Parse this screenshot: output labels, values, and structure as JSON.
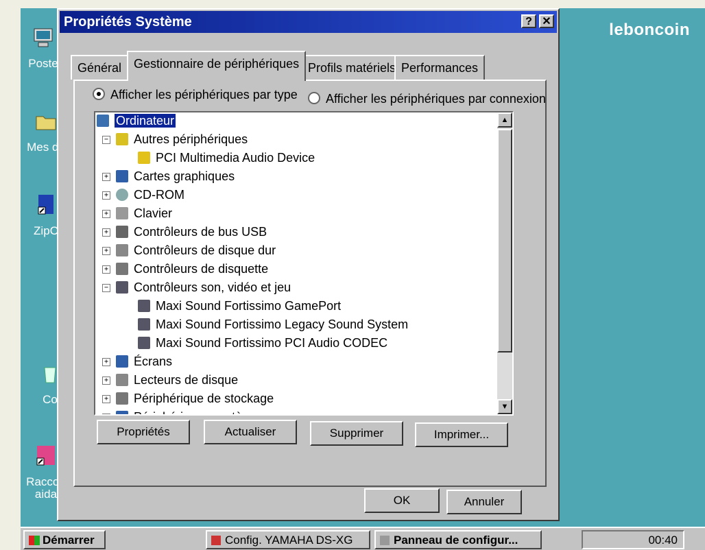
{
  "watermark": "leboncoin",
  "desktop_icons": [
    {
      "label": "Poste",
      "icon": "computer-icon"
    },
    {
      "label": "Mes do",
      "icon": "folder-icon"
    },
    {
      "label": "ZipC",
      "icon": "shortcut-icon"
    },
    {
      "label": "Co",
      "icon": "recycle-bin-icon"
    },
    {
      "label": "Raccou",
      "icon": "shortcut-icon"
    },
    {
      "label": "aida",
      "icon": ""
    }
  ],
  "dialog": {
    "title": "Propriétés Système",
    "help_label": "?",
    "close_label": "✕",
    "tabs": [
      "Général",
      "Gestionnaire de périphériques",
      "Profils matériels",
      "Performances"
    ],
    "active_tab": 1,
    "radio_by_type": "Afficher les périphériques par type",
    "radio_by_connection": "Afficher les périphériques par connexion",
    "tree": [
      {
        "label": "Ordinateur",
        "level": 0,
        "expander": "",
        "selected": true,
        "icon": "computer-icon"
      },
      {
        "label": "Autres périphériques",
        "level": 1,
        "expander": "−",
        "icon": "question-icon"
      },
      {
        "label": "PCI Multimedia Audio Device",
        "level": 2,
        "expander": "",
        "icon": "warning-icon"
      },
      {
        "label": "Cartes graphiques",
        "level": 1,
        "expander": "+",
        "icon": "monitor-icon"
      },
      {
        "label": "CD-ROM",
        "level": 1,
        "expander": "+",
        "icon": "cdrom-icon"
      },
      {
        "label": "Clavier",
        "level": 1,
        "expander": "+",
        "icon": "keyboard-icon"
      },
      {
        "label": "Contrôleurs de bus USB",
        "level": 1,
        "expander": "+",
        "icon": "usb-icon"
      },
      {
        "label": "Contrôleurs de disque dur",
        "level": 1,
        "expander": "+",
        "icon": "harddisk-icon"
      },
      {
        "label": "Contrôleurs de disquette",
        "level": 1,
        "expander": "+",
        "icon": "floppy-icon"
      },
      {
        "label": "Contrôleurs son, vidéo et jeu",
        "level": 1,
        "expander": "−",
        "icon": "sound-icon"
      },
      {
        "label": "Maxi Sound Fortissimo GamePort",
        "level": 2,
        "expander": "",
        "icon": "sound-icon"
      },
      {
        "label": "Maxi Sound Fortissimo Legacy Sound System",
        "level": 2,
        "expander": "",
        "icon": "sound-icon"
      },
      {
        "label": "Maxi Sound Fortissimo PCI Audio CODEC",
        "level": 2,
        "expander": "",
        "icon": "sound-icon"
      },
      {
        "label": "Écrans",
        "level": 1,
        "expander": "+",
        "icon": "monitor-icon"
      },
      {
        "label": "Lecteurs de disque",
        "level": 1,
        "expander": "+",
        "icon": "drive-icon"
      },
      {
        "label": "Périphérique de stockage",
        "level": 1,
        "expander": "+",
        "icon": "storage-icon"
      },
      {
        "label": "Périphériques système",
        "level": 1,
        "expander": "+",
        "icon": "monitor-icon"
      }
    ],
    "buttons": {
      "properties": "Propriétés",
      "refresh": "Actualiser",
      "remove": "Supprimer",
      "print": "Imprimer..."
    },
    "ok": "OK",
    "cancel": "Annuler"
  },
  "taskbar": {
    "start": "Démarrer",
    "items": [
      "Config. YAMAHA DS-XG",
      "Panneau de configur..."
    ],
    "clock": "00:40"
  }
}
